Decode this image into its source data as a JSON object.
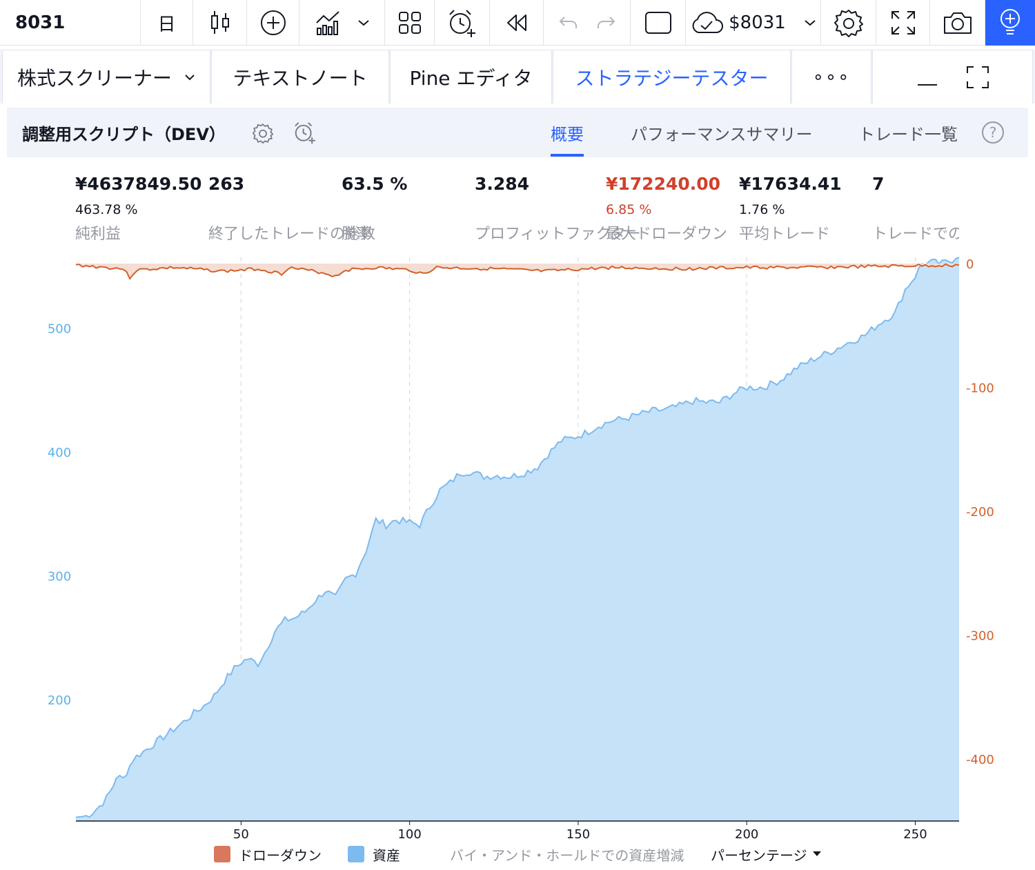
{
  "toolbar": {
    "symbol": "8031",
    "interval": "日",
    "cloud_label": "$8031",
    "icons": [
      "candles-icon",
      "plus-circle-icon",
      "indicators-icon",
      "chevron-down-icon",
      "layout-grid-icon",
      "alert-add-icon",
      "replay-icon",
      "undo-icon",
      "redo-icon",
      "rectangle-icon",
      "cloud-save-icon",
      "chevron-down-icon",
      "gear-icon",
      "fullscreen-icon",
      "camera-icon",
      "lightbulb-icon"
    ],
    "accent_color": "#2962ff"
  },
  "tabs": {
    "screener": "株式スクリーナー",
    "notes": "テキストノート",
    "pine": "Pine エディタ",
    "tester": "ストラテジーテスター",
    "more": "∘∘∘",
    "active": "tester"
  },
  "strategy": {
    "name": "調整用スクリプト（DEV）",
    "subtabs": {
      "overview": "概要",
      "performance": "パフォーマンスサマリー",
      "trades": "トレード一覧",
      "help": "?"
    },
    "active_subtab": "overview"
  },
  "metrics": [
    {
      "value": "¥4637849.50",
      "sub": "463.78 %",
      "label": "純利益"
    },
    {
      "value": "263",
      "sub": "",
      "label": "終了したトレードの総数"
    },
    {
      "value": "63.5 %",
      "sub": "",
      "label": "勝率"
    },
    {
      "value": "3.284",
      "sub": "",
      "label": "プロフィットファクター"
    },
    {
      "value": "¥172240.00",
      "sub": "6.85 %",
      "label": "最大ドローダウン",
      "color": "#d1402b"
    },
    {
      "value": "¥17634.41",
      "sub": "1.76 %",
      "label": "平均トレード"
    },
    {
      "value": "7",
      "sub": "",
      "label": "トレードでの平均バー数"
    }
  ],
  "chart_data": {
    "type": "area",
    "x_ticks": [
      50,
      100,
      150,
      200,
      250
    ],
    "xlim": [
      1,
      263
    ],
    "left_axis": {
      "ticks": [
        200,
        300,
        400,
        500
      ],
      "range": [
        102,
        557
      ],
      "color": "#5bb1eb"
    },
    "right_axis": {
      "ticks": [
        0,
        -100,
        -200,
        -300,
        -400
      ],
      "range": [
        -450,
        5
      ],
      "color": "#d1602b"
    },
    "series": [
      {
        "name": "資産",
        "color": "#7cbaf0",
        "anchor_values": [
          [
            1,
            105
          ],
          [
            4,
            106
          ],
          [
            6,
            109
          ],
          [
            8,
            114
          ],
          [
            10,
            120
          ],
          [
            12,
            130
          ],
          [
            13,
            138
          ],
          [
            15,
            136
          ],
          [
            18,
            152
          ],
          [
            21,
            158
          ],
          [
            24,
            164
          ],
          [
            27,
            170
          ],
          [
            30,
            176
          ],
          [
            33,
            182
          ],
          [
            36,
            189
          ],
          [
            39,
            195
          ],
          [
            42,
            203
          ],
          [
            45,
            215
          ],
          [
            48,
            225
          ],
          [
            50,
            230
          ],
          [
            52,
            233
          ],
          [
            55,
            229
          ],
          [
            57,
            238
          ],
          [
            60,
            255
          ],
          [
            63,
            264
          ],
          [
            66,
            266
          ],
          [
            69,
            271
          ],
          [
            72,
            280
          ],
          [
            75,
            288
          ],
          [
            78,
            282
          ],
          [
            81,
            297
          ],
          [
            84,
            302
          ],
          [
            87,
            320
          ],
          [
            90,
            345
          ],
          [
            93,
            341
          ],
          [
            96,
            345
          ],
          [
            100,
            343
          ],
          [
            103,
            341
          ],
          [
            106,
            356
          ],
          [
            109,
            369
          ],
          [
            112,
            375
          ],
          [
            115,
            383
          ],
          [
            118,
            384
          ],
          [
            122,
            380
          ],
          [
            126,
            381
          ],
          [
            130,
            380
          ],
          [
            134,
            383
          ],
          [
            138,
            388
          ],
          [
            141,
            398
          ],
          [
            145,
            409
          ],
          [
            148,
            411
          ],
          [
            152,
            415
          ],
          [
            156,
            421
          ],
          [
            160,
            425
          ],
          [
            164,
            427
          ],
          [
            168,
            430
          ],
          [
            172,
            433
          ],
          [
            176,
            434
          ],
          [
            180,
            437
          ],
          [
            184,
            441
          ],
          [
            188,
            440
          ],
          [
            192,
            440
          ],
          [
            196,
            447
          ],
          [
            200,
            452
          ],
          [
            205,
            452
          ],
          [
            210,
            458
          ],
          [
            215,
            468
          ],
          [
            220,
            475
          ],
          [
            225,
            481
          ],
          [
            230,
            488
          ],
          [
            235,
            494
          ],
          [
            240,
            505
          ],
          [
            244,
            512
          ],
          [
            247,
            531
          ],
          [
            250,
            542
          ],
          [
            252,
            552
          ],
          [
            255,
            553
          ],
          [
            258,
            552
          ],
          [
            261,
            555
          ],
          [
            263,
            557
          ]
        ]
      },
      {
        "name": "ドローダウン",
        "color": "#d1602b",
        "anchor_values": [
          [
            1,
            0
          ],
          [
            15,
            -3
          ],
          [
            17,
            -10
          ],
          [
            19,
            -4
          ],
          [
            30,
            -2
          ],
          [
            45,
            -5
          ],
          [
            55,
            -3
          ],
          [
            62,
            -7
          ],
          [
            64,
            -2
          ],
          [
            74,
            -6
          ],
          [
            78,
            -9
          ],
          [
            81,
            -4
          ],
          [
            90,
            -2
          ],
          [
            100,
            -4
          ],
          [
            104,
            -7
          ],
          [
            108,
            -2
          ],
          [
            125,
            -3
          ],
          [
            140,
            -5
          ],
          [
            160,
            -2
          ],
          [
            180,
            -3
          ],
          [
            200,
            -2
          ],
          [
            220,
            -2
          ],
          [
            240,
            -1
          ],
          [
            263,
            0
          ]
        ]
      }
    ],
    "legend": {
      "drawdown": "ドローダウン",
      "equity": "資産",
      "buy_hold": "バイ・アンド・ホールドでの資産増減",
      "mode": "パーセンテージ"
    },
    "grid": true
  }
}
